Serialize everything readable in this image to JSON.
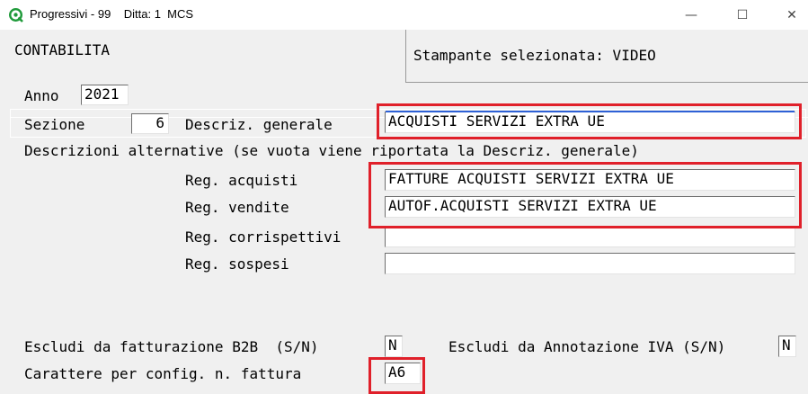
{
  "window": {
    "title": "Progressivi - 99    Ditta: 1  MCS",
    "minimize_glyph": "—",
    "maximize_glyph": "☐",
    "close_glyph": "✕"
  },
  "header": {
    "section": "CONTABILITA",
    "printer": "Stampante selezionata: VIDEO"
  },
  "form": {
    "anno_label": "Anno",
    "anno_value": "2021",
    "sezione_label": "Sezione",
    "sezione_value": "6",
    "descr_generale_label": "Descriz. generale",
    "descr_generale_value": "ACQUISTI SERVIZI EXTRA UE",
    "alt_desc_note": "Descrizioni alternative (se vuota viene riportata la Descriz. generale)",
    "reg_acquisti_label": "Reg. acquisti",
    "reg_acquisti_value": "FATTURE ACQUISTI SERVIZI EXTRA UE",
    "reg_vendite_label": "Reg. vendite",
    "reg_vendite_value": "AUTOF.ACQUISTI SERVIZI EXTRA UE",
    "reg_corrispettivi_label": "Reg. corrispettivi",
    "reg_corrispettivi_value": "",
    "reg_sospesi_label": "Reg. sospesi",
    "reg_sospesi_value": "",
    "escludi_b2b_label": "Escludi da fatturazione B2B  (S/N)",
    "escludi_b2b_value": "N",
    "escludi_iva_label": "Escludi da Annotazione IVA (S/N)",
    "escludi_iva_value": "N",
    "carattere_label": "Carattere per config. n. fattura",
    "carattere_value": "A6"
  },
  "colors": {
    "highlight": "#e0202a",
    "window_bg": "#f0f0f0",
    "focus": "#2e61d6"
  }
}
